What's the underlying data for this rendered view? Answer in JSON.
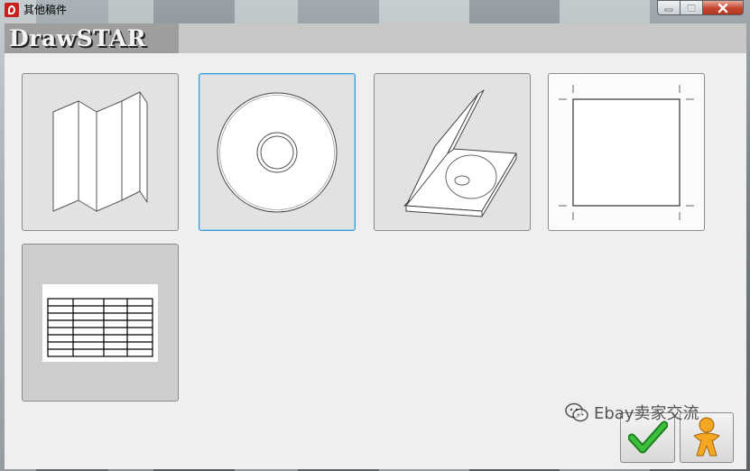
{
  "window": {
    "title": "其他稿件",
    "controls": {
      "minimize": "minimize-icon",
      "maximize": "maximize-icon",
      "close": "close-icon"
    }
  },
  "header": {
    "logo": "DrawSTAR"
  },
  "templates": [
    {
      "id": "folded-brochure",
      "icon": "folded-brochure-icon",
      "selected": false
    },
    {
      "id": "cd-disc",
      "icon": "cd-disc-icon",
      "selected": true
    },
    {
      "id": "cd-case",
      "icon": "cd-jewel-case-icon",
      "selected": false
    },
    {
      "id": "crop-marks-page",
      "icon": "crop-marks-page-icon",
      "selected": false
    },
    {
      "id": "table-grid",
      "icon": "table-grid-icon",
      "selected": false
    }
  ],
  "actions": {
    "ok": "checkmark-icon",
    "cancel": "person-figure-icon"
  },
  "watermark": {
    "text": "Ebay卖家交流",
    "icon": "wechat-icon"
  },
  "colors": {
    "selection_border": "#3d9bd4",
    "client_bg": "#efefef",
    "header_bar": "#c7c7c7",
    "ok_green": "#2faa2f",
    "cancel_orange": "#f2a21e"
  }
}
